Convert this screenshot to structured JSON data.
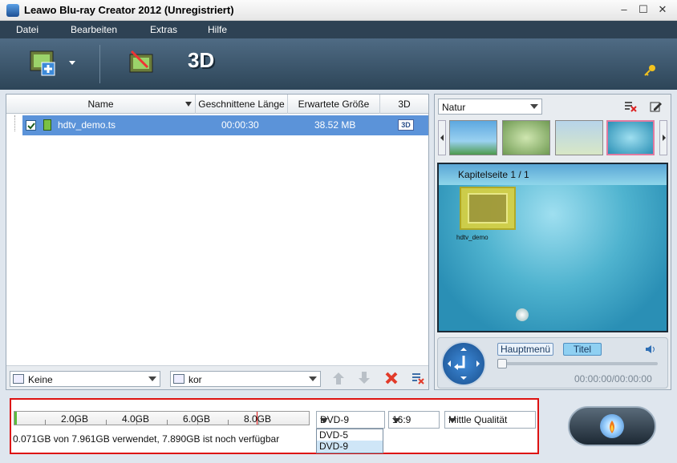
{
  "window": {
    "title": "Leawo Blu-ray Creator 2012 (Unregistriert)"
  },
  "menu": {
    "items": [
      "Datei",
      "Bearbeiten",
      "Extras",
      "Hilfe"
    ]
  },
  "toolbar": {
    "threed_label": "3D"
  },
  "table": {
    "headers": [
      "Name",
      "Geschnittene Länge",
      "Erwartete Größe",
      "3D"
    ],
    "rows": [
      {
        "name": "hdtv_demo.ts",
        "length": "00:00:30",
        "size": "38.52 MB",
        "checked": true
      }
    ]
  },
  "left_bottom": {
    "subtitle_value": "Keine",
    "audio_value": "kor"
  },
  "template": {
    "theme_value": "Natur",
    "preview_title": "Kapitelseite 1 / 1",
    "chapter_caption": "hdtv_demo"
  },
  "player": {
    "main_menu_label": "Hauptmenü",
    "title_label": "Titel",
    "time": "00:00:00/00:00:00"
  },
  "disc": {
    "gb_labels": [
      "2.0GB",
      "4.0GB",
      "6.0GB",
      "8.0GB"
    ],
    "used_fraction": 0.009,
    "usage_text": "0.071GB von 7.961GB verwendet, 7.890GB ist noch verfügbar",
    "disc_type": "DVD-9",
    "disc_options": [
      "DVD-5",
      "DVD-9"
    ],
    "aspect": "16:9",
    "quality": "Mittle Qualität"
  },
  "colors": {
    "selection": "#5b93d9",
    "menubar": "#2e4254",
    "accent_red": "#d11"
  }
}
